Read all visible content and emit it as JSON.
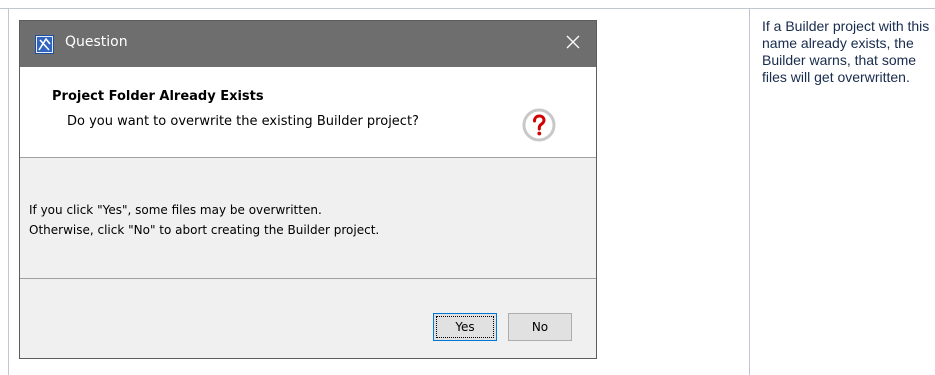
{
  "dialog": {
    "title": "Question",
    "heading": "Project Folder Already Exists",
    "message": "Do you want to overwrite the existing Builder project?",
    "details": [
      "If you click \"Yes\", some files may be overwritten.",
      "Otherwise, click \"No\" to abort creating the Builder project."
    ],
    "buttons": {
      "yes": "Yes",
      "no": "No"
    }
  },
  "side_note": "If a Builder project with this name already exists, the Builder warns, that some files will get overwritten.",
  "colors": {
    "titlebar": "#6e6e6e",
    "question_ring": "#c8c8c8",
    "question_mark": "#d00000",
    "focus_border": "#0078d7"
  },
  "icons": {
    "title": "app-logo-icon",
    "close": "close-icon",
    "question": "question-icon"
  }
}
